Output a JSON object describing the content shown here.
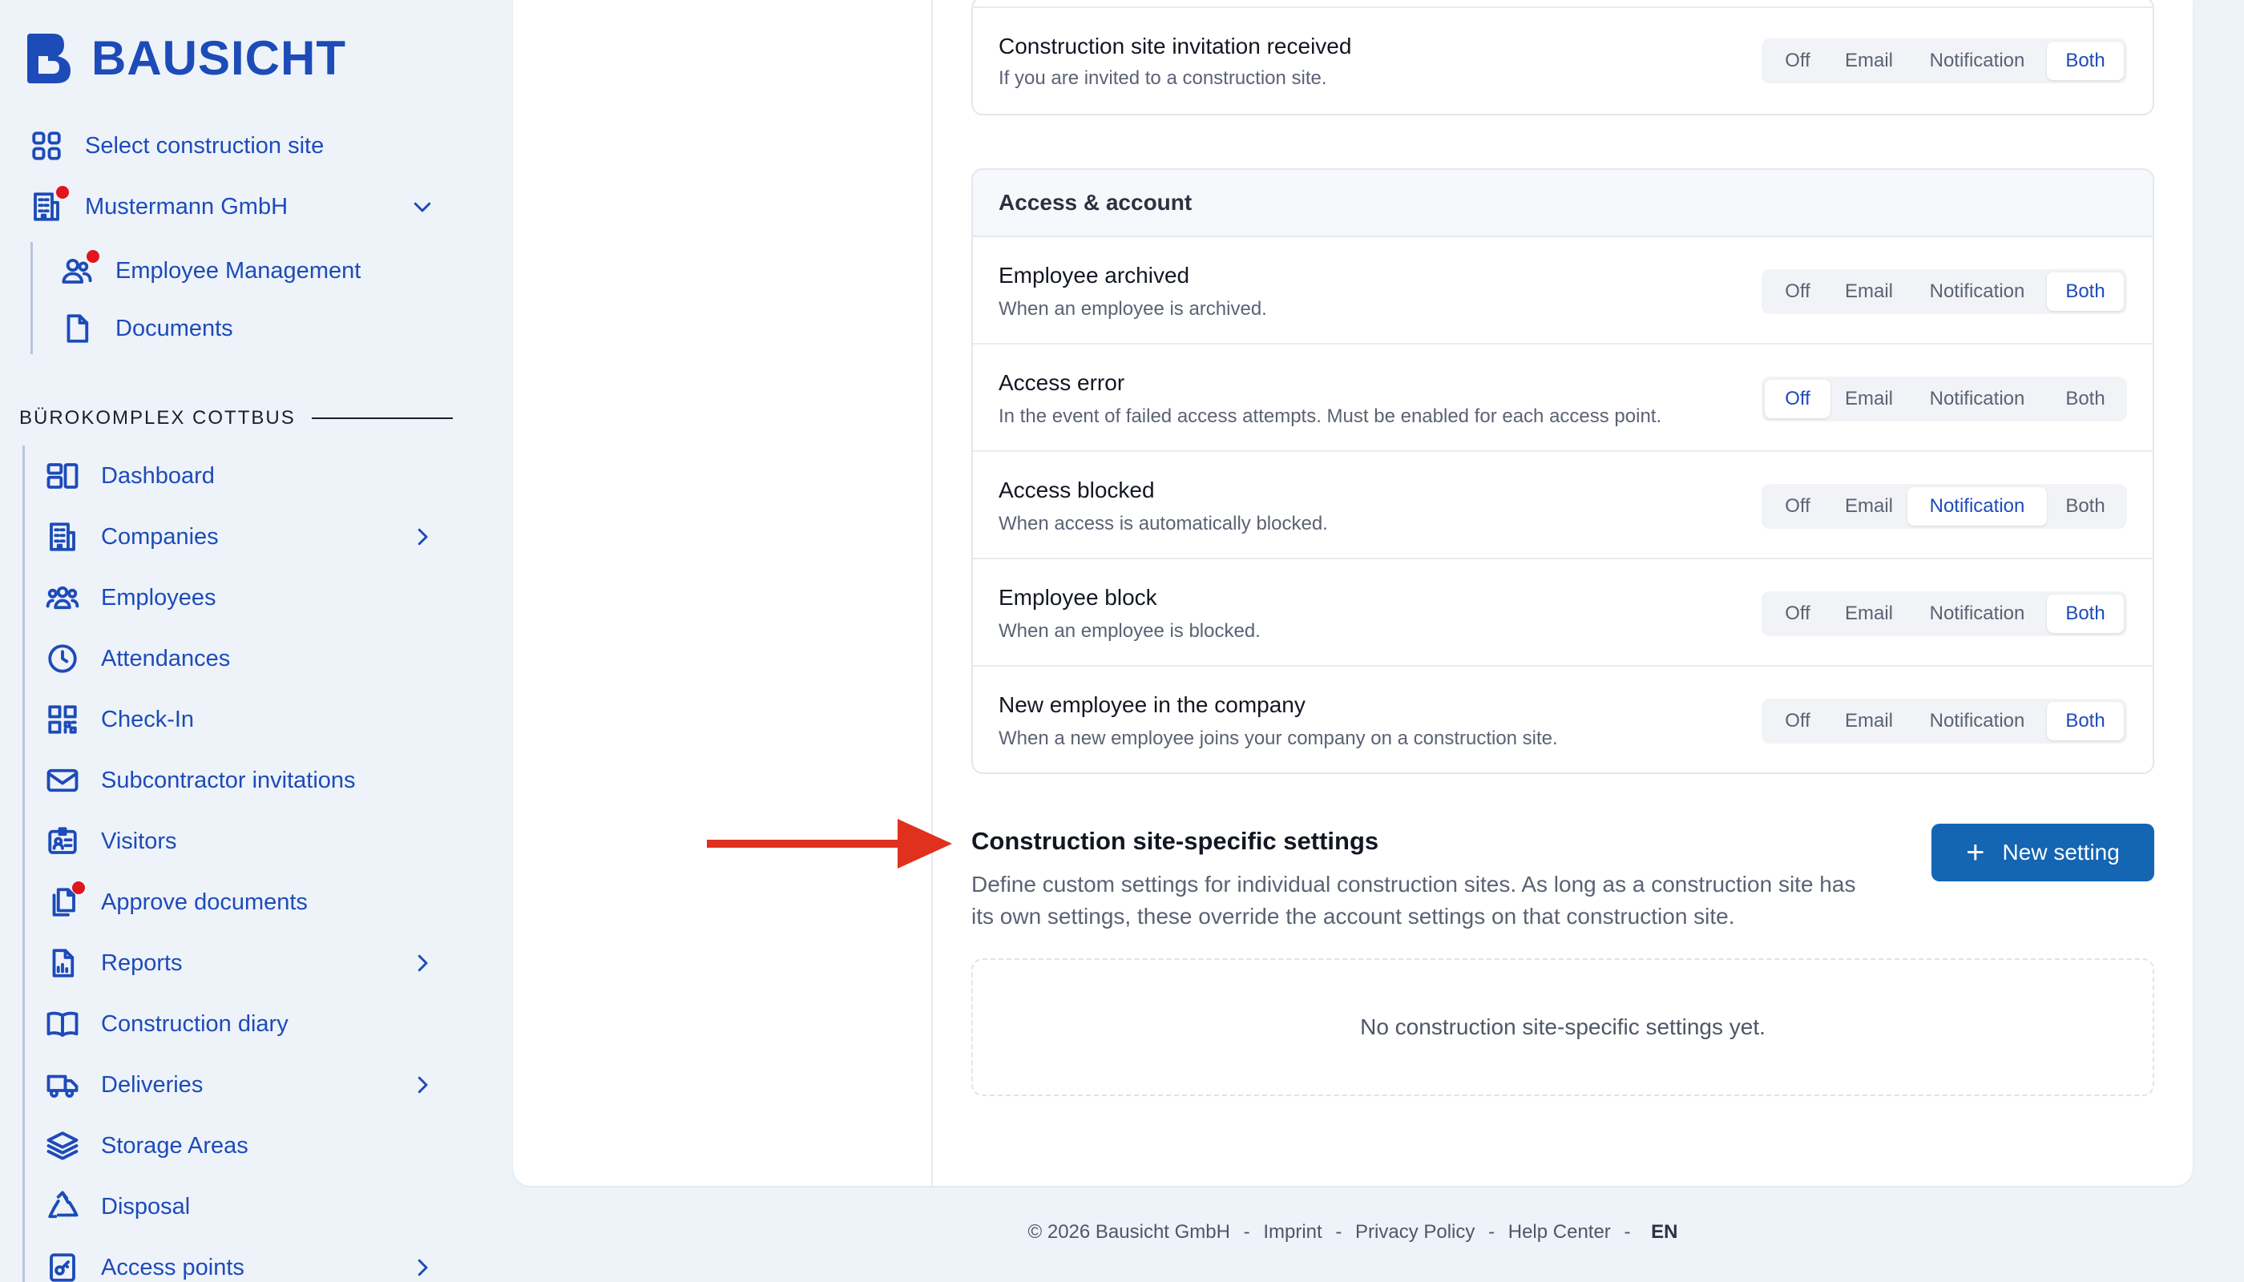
{
  "brand": {
    "name": "BAUSICHT"
  },
  "sidebar": {
    "top_items": [
      {
        "label": "Select construction site"
      },
      {
        "label": "Mustermann GmbH"
      }
    ],
    "company_children": [
      {
        "label": "Employee Management"
      },
      {
        "label": "Documents"
      }
    ],
    "section_title": "BÜROKOMPLEX COTTBUS",
    "items": [
      {
        "label": "Dashboard"
      },
      {
        "label": "Companies"
      },
      {
        "label": "Employees"
      },
      {
        "label": "Attendances"
      },
      {
        "label": "Check-In"
      },
      {
        "label": "Subcontractor invitations"
      },
      {
        "label": "Visitors"
      },
      {
        "label": "Approve documents"
      },
      {
        "label": "Reports"
      },
      {
        "label": "Construction diary"
      },
      {
        "label": "Deliveries"
      },
      {
        "label": "Storage Areas"
      },
      {
        "label": "Disposal"
      },
      {
        "label": "Access points"
      }
    ]
  },
  "options": {
    "off": "Off",
    "email": "Email",
    "notification": "Notification",
    "both": "Both"
  },
  "invitation_row": {
    "title": "Construction site invitation received",
    "desc": "If you are invited to a construction site.",
    "selected": "Both"
  },
  "access_card": {
    "title": "Access & account",
    "rows": [
      {
        "title": "Employee archived",
        "desc": "When an employee is archived.",
        "selected": "Both"
      },
      {
        "title": "Access error",
        "desc": "In the event of failed access attempts. Must be enabled for each access point.",
        "selected": "Off"
      },
      {
        "title": "Access blocked",
        "desc": "When access is automatically blocked.",
        "selected": "Notification"
      },
      {
        "title": "Employee block",
        "desc": "When an employee is blocked.",
        "selected": "Both"
      },
      {
        "title": "New employee in the company",
        "desc": "When a new employee joins your company on a construction site.",
        "selected": "Both"
      }
    ]
  },
  "site_settings": {
    "title": "Construction site-specific settings",
    "desc": "Define custom settings for individual construction sites. As long as a construction site has its own settings, these override the account settings on that construction site.",
    "new_button": "New setting",
    "empty": "No construction site-specific settings yet."
  },
  "footer": {
    "copyright": "© 2026 Bausicht GmbH",
    "sep": "-",
    "imprint": "Imprint",
    "privacy": "Privacy Policy",
    "help": "Help Center",
    "lang": "EN"
  },
  "colors": {
    "brand": "#1d4bb8",
    "primary_button": "#1465b2",
    "badge": "#e0161b",
    "arrow": "#e0301e"
  }
}
